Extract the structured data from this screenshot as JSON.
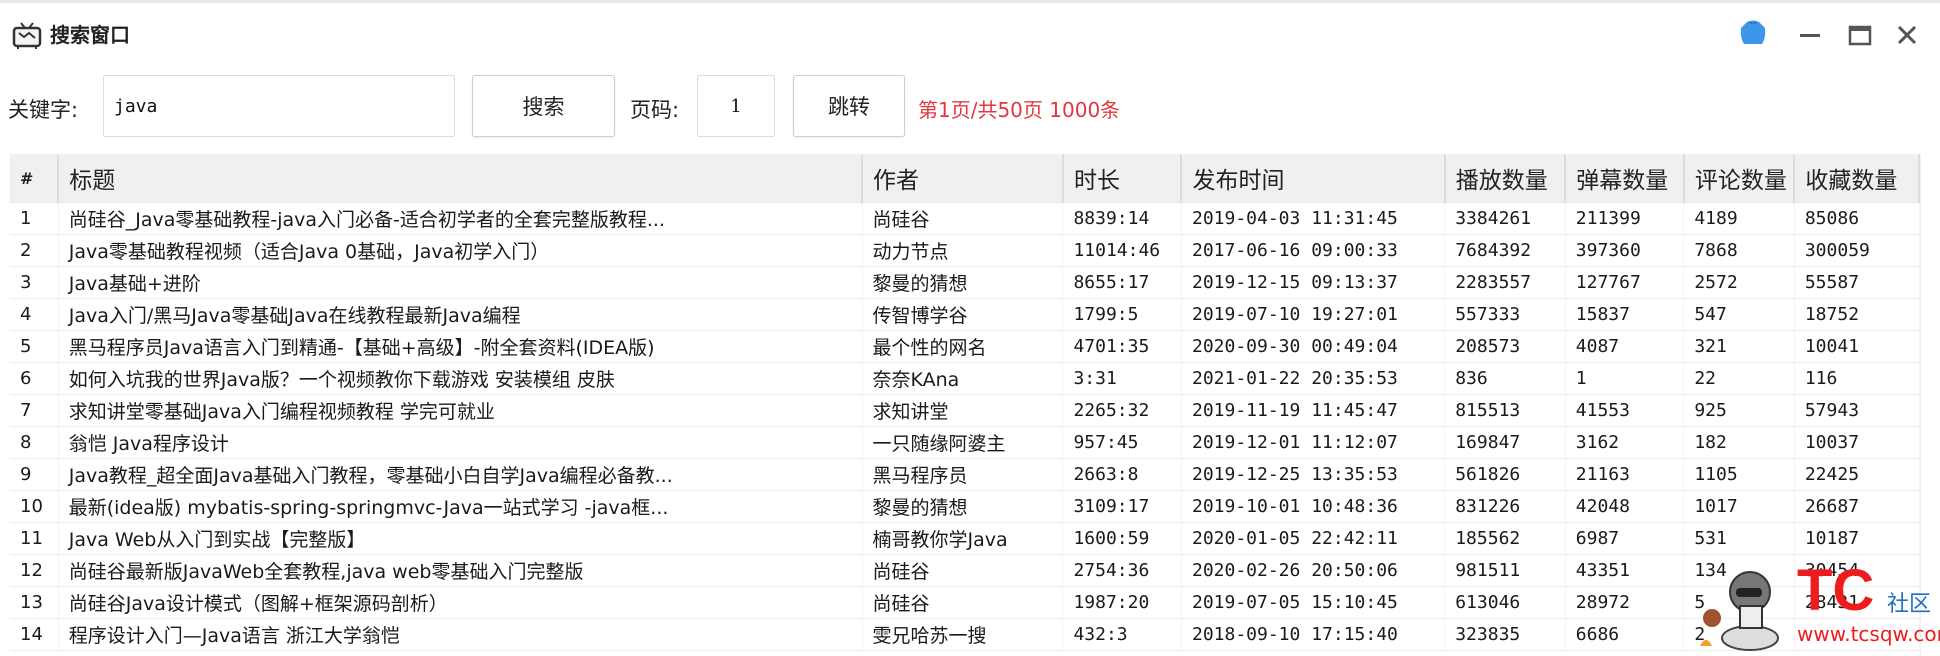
{
  "window": {
    "title": "搜索窗口",
    "icons": {
      "app": "tv-icon",
      "skin": "shirt-icon",
      "minimize": "minimize-icon",
      "maximize": "maximize-icon",
      "close": "close-icon"
    },
    "colors": {
      "skin_icon": "#3d96e8",
      "page_info": "#e0383d"
    }
  },
  "search": {
    "keyword_label": "关键字:",
    "keyword_value": "java",
    "search_button": "搜索",
    "page_label": "页码:",
    "page_value": "1",
    "jump_button": "跳转",
    "page_info": "第1页/共50页 1000条"
  },
  "table": {
    "columns": [
      "#",
      "标题",
      "作者",
      "时长",
      "发布时间",
      "播放数量",
      "弹幕数量",
      "评论数量",
      "收藏数量"
    ],
    "rows": [
      {
        "idx": "1",
        "title": "尚硅谷_Java零基础教程-java入门必备-适合初学者的全套完整版教程...",
        "author": "尚硅谷",
        "duration": "8839:14",
        "published": "2019-04-03 11:31:45",
        "plays": "3384261",
        "danmaku": "211399",
        "comments": "4189",
        "favorites": "85086"
      },
      {
        "idx": "2",
        "title": "Java零基础教程视频（适合Java 0基础，Java初学入门）",
        "author": "动力节点",
        "duration": "11014:46",
        "published": "2017-06-16 09:00:33",
        "plays": "7684392",
        "danmaku": "397360",
        "comments": "7868",
        "favorites": "300059"
      },
      {
        "idx": "3",
        "title": "Java基础+进阶",
        "author": "黎曼的猜想",
        "duration": "8655:17",
        "published": "2019-12-15 09:13:37",
        "plays": "2283557",
        "danmaku": "127767",
        "comments": "2572",
        "favorites": "55587"
      },
      {
        "idx": "4",
        "title": "Java入门/黑马Java零基础Java在线教程最新Java编程",
        "author": "传智博学谷",
        "duration": "1799:5",
        "published": "2019-07-10 19:27:01",
        "plays": "557333",
        "danmaku": "15837",
        "comments": "547",
        "favorites": "18752"
      },
      {
        "idx": "5",
        "title": "黑马程序员Java语言入门到精通-【基础+高级】-附全套资料(IDEA版)",
        "author": "最个性的网名",
        "duration": "4701:35",
        "published": "2020-09-30 00:49:04",
        "plays": "208573",
        "danmaku": "4087",
        "comments": "321",
        "favorites": "10041"
      },
      {
        "idx": "6",
        "title": "如何入坑我的世界Java版？一个视频教你下载游戏 安装模组 皮肤",
        "author": "奈奈KAna",
        "duration": "3:31",
        "published": "2021-01-22 20:35:53",
        "plays": "836",
        "danmaku": "1",
        "comments": "22",
        "favorites": "116"
      },
      {
        "idx": "7",
        "title": "求知讲堂零基础Java入门编程视频教程 学完可就业",
        "author": "求知讲堂",
        "duration": "2265:32",
        "published": "2019-11-19 11:45:47",
        "plays": "815513",
        "danmaku": "41553",
        "comments": "925",
        "favorites": "57943"
      },
      {
        "idx": "8",
        "title": "翁恺  Java程序设计",
        "author": "一只随缘阿婆主",
        "duration": "957:45",
        "published": "2019-12-01 11:12:07",
        "plays": "169847",
        "danmaku": "3162",
        "comments": "182",
        "favorites": "10037"
      },
      {
        "idx": "9",
        "title": "Java教程_超全面Java基础入门教程，零基础小白自学Java编程必备教...",
        "author": "黑马程序员",
        "duration": "2663:8",
        "published": "2019-12-25 13:35:53",
        "plays": "561826",
        "danmaku": "21163",
        "comments": "1105",
        "favorites": "22425"
      },
      {
        "idx": "10",
        "title": "最新(idea版) mybatis-spring-springmvc-Java一站式学习 -java框...",
        "author": "黎曼的猜想",
        "duration": "3109:17",
        "published": "2019-10-01 10:48:36",
        "plays": "831226",
        "danmaku": "42048",
        "comments": "1017",
        "favorites": "26687"
      },
      {
        "idx": "11",
        "title": "Java Web从入门到实战【完整版】",
        "author": "楠哥教你学Java",
        "duration": "1600:59",
        "published": "2020-01-05 22:42:11",
        "plays": "185562",
        "danmaku": "6987",
        "comments": "531",
        "favorites": "10187"
      },
      {
        "idx": "12",
        "title": "尚硅谷最新版JavaWeb全套教程,java web零基础入门完整版",
        "author": "尚硅谷",
        "duration": "2754:36",
        "published": "2020-02-26 20:50:06",
        "plays": "981511",
        "danmaku": "43351",
        "comments": "134",
        "favorites": "30454"
      },
      {
        "idx": "13",
        "title": "尚硅谷Java设计模式（图解+框架源码剖析）",
        "author": "尚硅谷",
        "duration": "1987:20",
        "published": "2019-07-05 15:10:45",
        "plays": "613046",
        "danmaku": "28972",
        "comments": "5",
        "favorites": "28431"
      },
      {
        "idx": "14",
        "title": "程序设计入门—Java语言 浙江大学翁恺",
        "author": "雯兄哈苏一搜",
        "duration": "432:3",
        "published": "2018-09-10 17:15:40",
        "plays": "323835",
        "danmaku": "6686",
        "comments": "2",
        "favorites": ""
      }
    ]
  },
  "watermark": {
    "logo": "TC",
    "label": "社区",
    "url": "www.tcsqw.com"
  }
}
